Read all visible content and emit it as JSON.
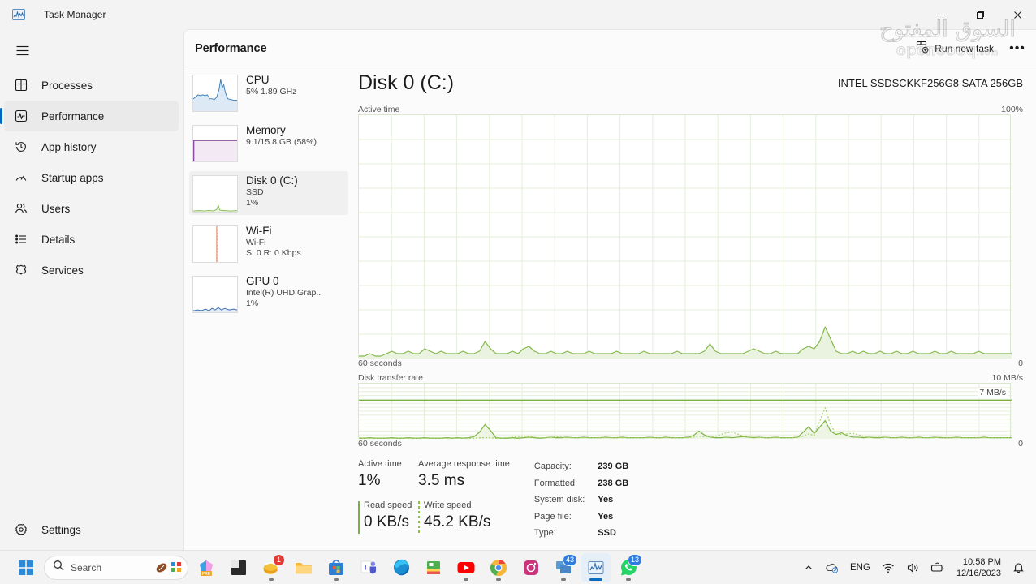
{
  "window": {
    "title": "Task Manager",
    "icon": "task-manager-icon",
    "minimize": "—",
    "maximize": "❐",
    "close": "✕"
  },
  "nav": {
    "menu_icon": "hamburger-icon",
    "items": [
      {
        "label": "Processes",
        "icon": "processes-icon",
        "active": false
      },
      {
        "label": "Performance",
        "icon": "performance-icon",
        "active": true
      },
      {
        "label": "App history",
        "icon": "history-icon",
        "active": false
      },
      {
        "label": "Startup apps",
        "icon": "startup-icon",
        "active": false
      },
      {
        "label": "Users",
        "icon": "users-icon",
        "active": false
      },
      {
        "label": "Details",
        "icon": "details-icon",
        "active": false
      },
      {
        "label": "Services",
        "icon": "services-icon",
        "active": false
      }
    ],
    "settings": {
      "label": "Settings",
      "icon": "gear-icon"
    }
  },
  "content": {
    "title": "Performance",
    "run_new_task": "Run new task",
    "run_new_task_icon": "new-task-icon",
    "more_options": "•••"
  },
  "perf_list": [
    {
      "name": "CPU",
      "line1": "5%  1.89 GHz",
      "line2": "",
      "color": "#3a7dba",
      "active": false
    },
    {
      "name": "Memory",
      "line1": "9.1/15.8 GB (58%)",
      "line2": "",
      "color": "#8b4f9f",
      "active": false
    },
    {
      "name": "Disk 0 (C:)",
      "line1": "SSD",
      "line2": "1%",
      "color": "#84b84c",
      "active": true
    },
    {
      "name": "Wi-Fi",
      "line1": "Wi-Fi",
      "line2": "S: 0 R: 0 Kbps",
      "color": "#d98a6a",
      "active": false
    },
    {
      "name": "GPU 0",
      "line1": "Intel(R) UHD Grap...",
      "line2": "1%",
      "color": "#3b6fb5",
      "active": false
    }
  ],
  "disk": {
    "title": "Disk 0 (C:)",
    "model": "INTEL SSDSCKKF256G8 SATA 256GB",
    "accent": "#84b84c"
  },
  "chart_data": [
    {
      "type": "area",
      "name": "active-time-graph",
      "title": "Active time",
      "ymax_label": "100%",
      "ymin_label": "0",
      "xlabel": "60 seconds",
      "ylim": [
        0,
        100
      ],
      "grid": true,
      "grid_cols": 20,
      "grid_rows": 10,
      "series": [
        {
          "name": "Active time",
          "color": "#84b84c",
          "fill": "#eaf3e0",
          "values": [
            1,
            1,
            2,
            1,
            1,
            2,
            3,
            2,
            2,
            3,
            2,
            2,
            4,
            3,
            2,
            3,
            2,
            2,
            2,
            3,
            2,
            2,
            3,
            7,
            4,
            2,
            2,
            2,
            3,
            2,
            4,
            5,
            3,
            2,
            2,
            3,
            2,
            2,
            3,
            2,
            2,
            2,
            3,
            2,
            2,
            2,
            2,
            3,
            2,
            2,
            2,
            2,
            3,
            2,
            2,
            2,
            2,
            2,
            3,
            2,
            2,
            2,
            2,
            3,
            6,
            3,
            2,
            2,
            2,
            2,
            2,
            3,
            4,
            3,
            2,
            2,
            3,
            2,
            2,
            2,
            2,
            4,
            5,
            4,
            7,
            13,
            8,
            3,
            2,
            2,
            3,
            2,
            3,
            2,
            2,
            3,
            2,
            2,
            3,
            2,
            2,
            3,
            2,
            2,
            2,
            3,
            2,
            2,
            3,
            2,
            2,
            2,
            2,
            3,
            2,
            2,
            2,
            2,
            2,
            2
          ]
        }
      ]
    },
    {
      "type": "line",
      "name": "disk-transfer-rate-graph",
      "title": "Disk transfer rate",
      "ymax_label": "10 MB/s",
      "ymin_label": "0",
      "marker_label": "7 MB/s",
      "marker_value": 7,
      "xlabel": "60 seconds",
      "ylim": [
        0,
        10
      ],
      "grid": true,
      "grid_cols": 20,
      "grid_rows": 14,
      "series": [
        {
          "name": "Write speed",
          "style": "solid",
          "color": "#7bb342",
          "fill": "#eef5e4",
          "values": [
            0.1,
            0.1,
            0.2,
            0.1,
            0.1,
            0.1,
            0.2,
            0.1,
            0.1,
            0.2,
            0.1,
            0.1,
            0.2,
            0.1,
            0.1,
            0.1,
            0.2,
            0.1,
            0.2,
            0.1,
            0.2,
            0.4,
            1.2,
            2.6,
            1.5,
            0.2,
            0.1,
            0.1,
            0.2,
            0.1,
            0.2,
            0.3,
            0.2,
            0.1,
            0.2,
            0.3,
            0.2,
            0.2,
            0.3,
            0.2,
            0.2,
            0.3,
            0.2,
            0.2,
            0.2,
            0.3,
            0.2,
            0.2,
            0.3,
            0.2,
            0.2,
            0.2,
            0.2,
            0.3,
            0.2,
            0.2,
            0.3,
            0.2,
            0.2,
            0.2,
            0.3,
            0.6,
            1.4,
            0.7,
            0.3,
            0.2,
            0.2,
            0.3,
            0.2,
            0.3,
            0.4,
            0.3,
            0.2,
            0.3,
            0.2,
            0.2,
            0.3,
            0.2,
            0.2,
            0.2,
            0.3,
            1.2,
            2.2,
            1.0,
            2.1,
            3.3,
            1.4,
            0.8,
            1.1,
            0.6,
            0.3,
            0.3,
            0.2,
            0.3,
            0.2,
            0.2,
            0.3,
            0.2,
            0.2,
            0.3,
            0.2,
            0.2,
            0.3,
            0.2,
            0.2,
            0.3,
            0.2,
            0.2,
            0.2,
            0.3,
            0.2,
            0.2,
            0.2,
            0.2,
            0.3,
            0.2,
            0.2,
            0.2,
            0.2,
            0.2
          ]
        },
        {
          "name": "Read speed",
          "style": "dotted",
          "color": "#a8d06a",
          "values": [
            0.1,
            0.1,
            0.1,
            0.1,
            0.1,
            0.1,
            0.1,
            0.1,
            0.1,
            0.1,
            0.1,
            0.1,
            0.1,
            0.1,
            0.1,
            0.1,
            0.1,
            0.1,
            0.1,
            0.1,
            0.1,
            0.1,
            0.2,
            0.2,
            0.2,
            0.1,
            0.1,
            0.2,
            0.3,
            0.4,
            0.5,
            0.4,
            0.3,
            0.2,
            0.2,
            0.3,
            0.4,
            0.3,
            0.2,
            0.2,
            0.2,
            0.2,
            0.2,
            0.2,
            0.2,
            0.2,
            0.2,
            0.2,
            0.2,
            0.2,
            0.2,
            0.2,
            0.2,
            0.2,
            0.2,
            0.2,
            0.2,
            0.2,
            0.2,
            0.2,
            0.2,
            0.3,
            0.5,
            0.4,
            0.3,
            0.4,
            0.8,
            1.1,
            1.2,
            0.9,
            0.5,
            0.3,
            0.3,
            0.3,
            0.2,
            0.2,
            0.2,
            0.2,
            0.2,
            0.2,
            0.3,
            0.5,
            0.9,
            0.6,
            3.2,
            5.6,
            2.4,
            1.0,
            0.8,
            0.9,
            1.0,
            0.8,
            0.4,
            0.3,
            0.3,
            0.3,
            0.3,
            0.2,
            0.2,
            0.2,
            0.2,
            0.2,
            0.2,
            0.2,
            0.2,
            0.2,
            0.3,
            0.2,
            0.2,
            0.2,
            0.2,
            0.2,
            0.2,
            0.2,
            0.2,
            0.2,
            0.2,
            0.2,
            0.2,
            0.2
          ]
        }
      ]
    }
  ],
  "stats": {
    "active_time": {
      "label": "Active time",
      "value": "1%"
    },
    "avg_response": {
      "label": "Average response time",
      "value": "3.5 ms"
    },
    "read_speed": {
      "label": "Read speed",
      "value": "0 KB/s"
    },
    "write_speed": {
      "label": "Write speed",
      "value": "45.2 KB/s"
    },
    "info": [
      {
        "key": "Capacity:",
        "value": "239 GB"
      },
      {
        "key": "Formatted:",
        "value": "238 GB"
      },
      {
        "key": "System disk:",
        "value": "Yes"
      },
      {
        "key": "Page file:",
        "value": "Yes"
      },
      {
        "key": "Type:",
        "value": "SSD"
      }
    ]
  },
  "watermark": {
    "arabic": "السوق المفتوح",
    "english": "opensooq",
    "tld": ".com"
  },
  "taskbar": {
    "start_icon": "windows-start-icon",
    "search": {
      "placeholder": "Search",
      "icon": "search-icon"
    },
    "apps": [
      {
        "name": "pre-app-icon",
        "badge": ""
      },
      {
        "name": "lightroom-icon",
        "badge": ""
      },
      {
        "name": "mail-icon",
        "badge": "1"
      },
      {
        "name": "file-explorer-icon",
        "badge": ""
      },
      {
        "name": "microsoft-store-icon",
        "badge": ""
      },
      {
        "name": "microsoft-teams-icon",
        "badge": ""
      },
      {
        "name": "microsoft-edge-icon",
        "badge": ""
      },
      {
        "name": "book-app-icon",
        "badge": ""
      },
      {
        "name": "youtube-icon",
        "badge": ""
      },
      {
        "name": "google-chrome-icon",
        "badge": ""
      },
      {
        "name": "instagram-icon",
        "badge": ""
      },
      {
        "name": "remote-desktop-icon",
        "badge": "43"
      },
      {
        "name": "task-manager-icon",
        "badge": ""
      },
      {
        "name": "whatsapp-icon",
        "badge": "13"
      }
    ],
    "tray": {
      "chevron": "⌃",
      "onedrive_icon": "onedrive-icon",
      "language": "ENG",
      "wifi_icon": "wifi-icon",
      "volume_icon": "speaker-icon",
      "battery_icon": "battery-icon",
      "time": "10:58 PM",
      "date": "12/16/2023",
      "notification_icon": "bell-icon"
    }
  }
}
